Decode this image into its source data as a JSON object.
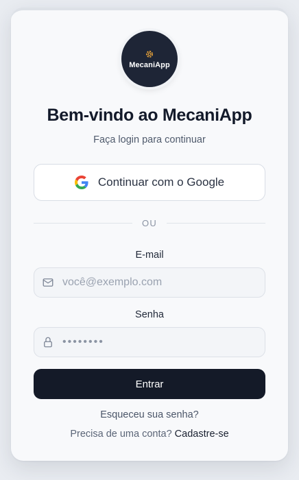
{
  "brand": {
    "logo_text": "MecaniApp",
    "logo_icon": "gear-icon",
    "accent_color": "#e8a33a"
  },
  "header": {
    "title": "Bem-vindo ao MecaniApp",
    "subtitle": "Faça login para continuar"
  },
  "google_button": {
    "label": "Continuar com o Google",
    "icon": "google-icon"
  },
  "divider": {
    "text": "OU"
  },
  "email": {
    "label": "E-mail",
    "placeholder": "você@exemplo.com",
    "value": "",
    "icon": "mail-icon"
  },
  "password": {
    "label": "Senha",
    "value": "••••••••",
    "icon": "lock-icon"
  },
  "submit": {
    "label": "Entrar",
    "color": "#141a28"
  },
  "links": {
    "forgot": "Esqueceu sua senha?",
    "signup_prompt": "Precisa de uma conta?",
    "signup_link": "Cadastre-se"
  }
}
